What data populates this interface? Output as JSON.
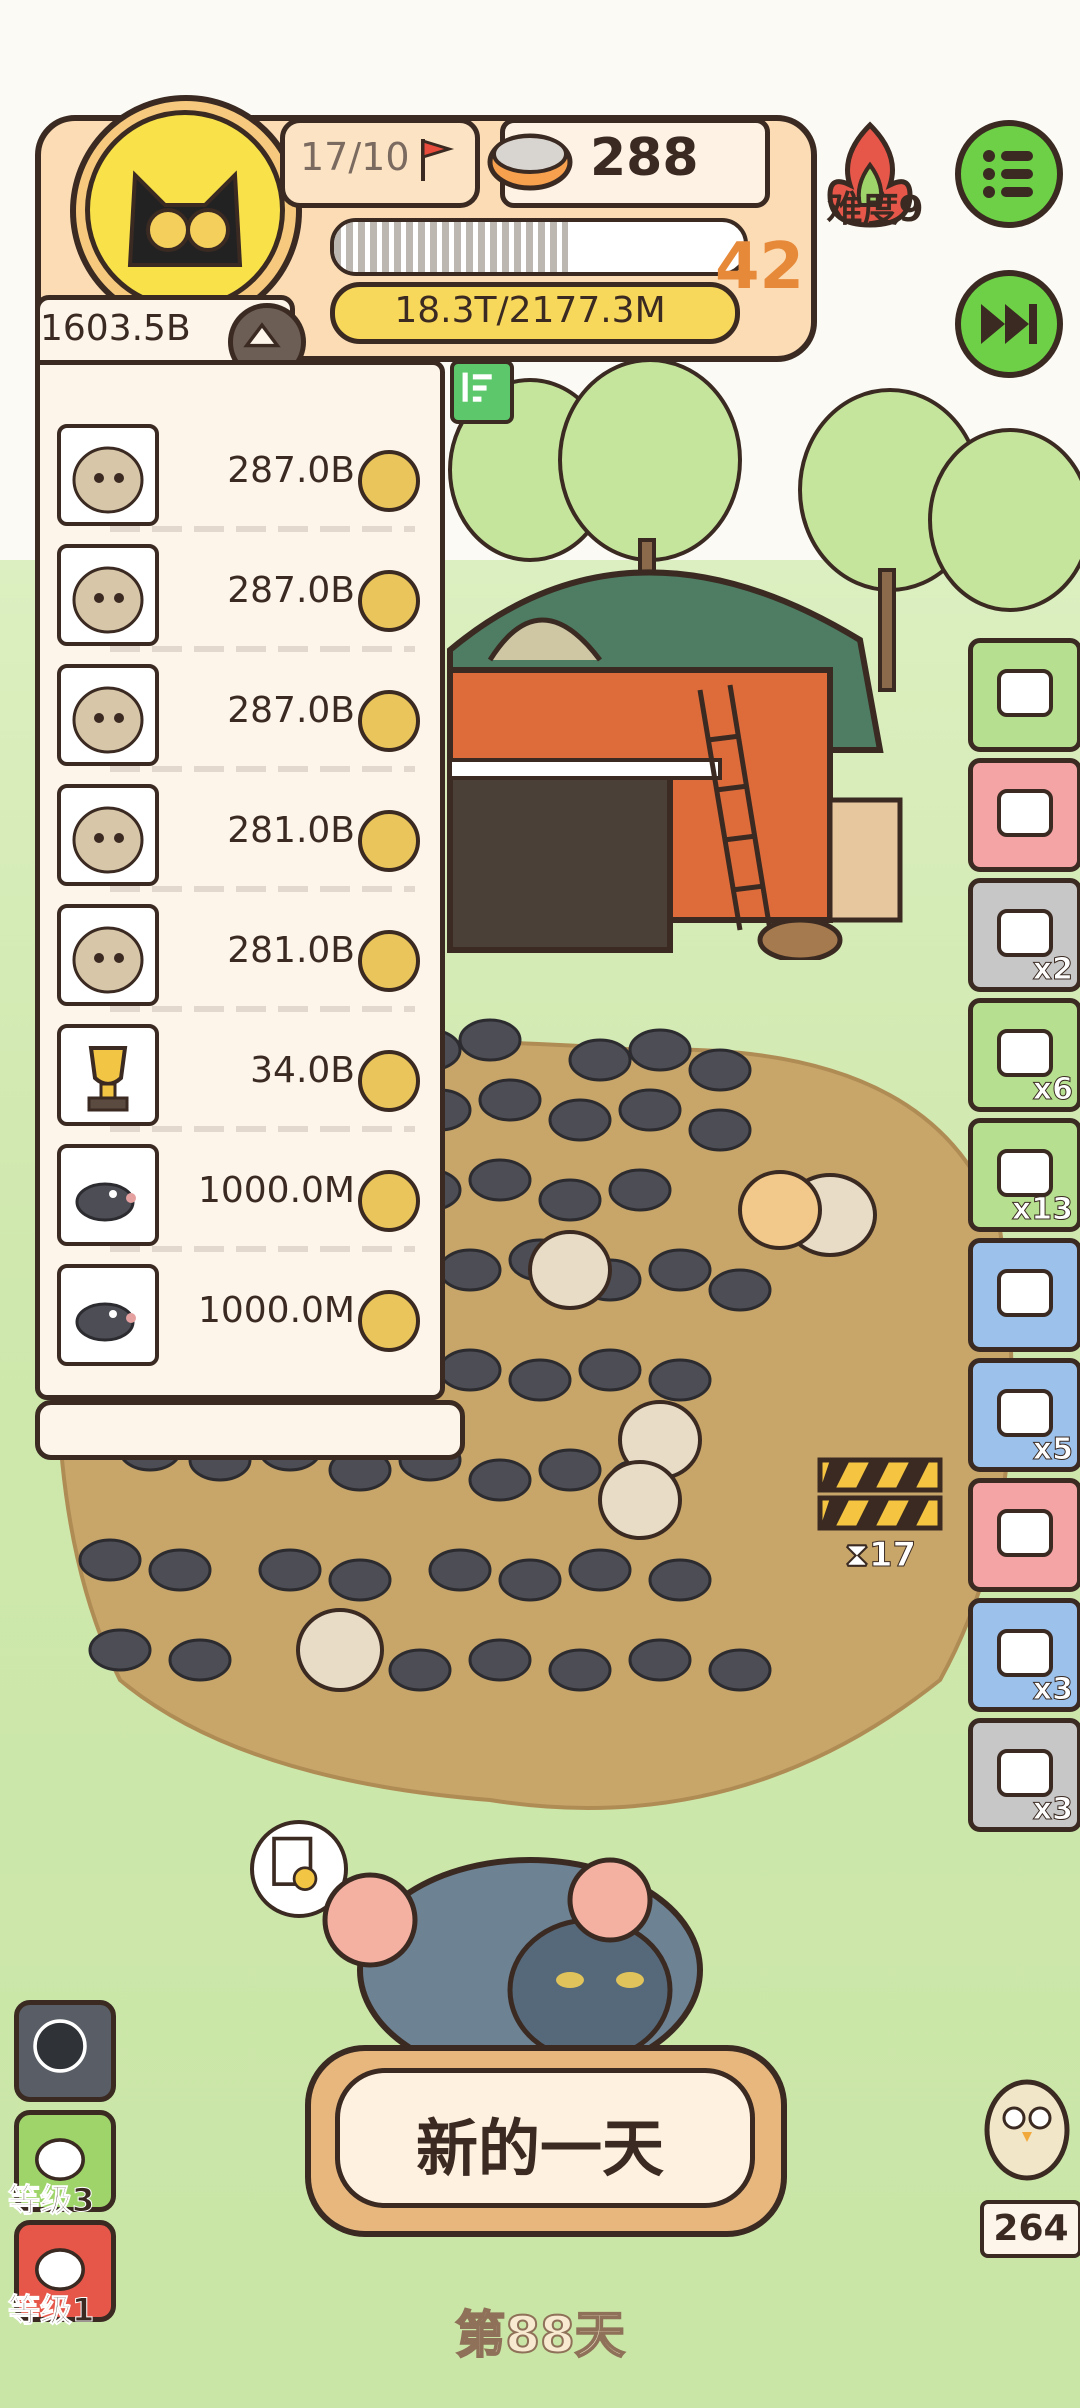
{
  "hud": {
    "population": "17/10",
    "food": "288",
    "level": "42",
    "money": "18.3T/2177.3M",
    "progress": 0.57,
    "difficulty_label": "难度9"
  },
  "ranking": {
    "total": "1603.5B",
    "rows": [
      {
        "creature": "hedgehog",
        "value": "287.0B"
      },
      {
        "creature": "hedgehog",
        "value": "287.0B"
      },
      {
        "creature": "hedgehog",
        "value": "287.0B"
      },
      {
        "creature": "hedgehog",
        "value": "281.0B"
      },
      {
        "creature": "hedgehog",
        "value": "281.0B"
      },
      {
        "creature": "trophy",
        "value": "34.0B"
      },
      {
        "creature": "mole",
        "value": "1000.0M"
      },
      {
        "creature": "mole",
        "value": "1000.0M"
      }
    ]
  },
  "items": [
    {
      "icon": "card-icon",
      "count": "",
      "color": "#b6e08f"
    },
    {
      "icon": "gift-box-icon",
      "count": "",
      "color": "#f4a4a4"
    },
    {
      "icon": "mushroom-icon",
      "count": "x2",
      "color": "#c7c7c7"
    },
    {
      "icon": "tent-icon",
      "count": "x6",
      "color": "#b6e08f"
    },
    {
      "icon": "ticket-icon",
      "count": "x13",
      "color": "#b6e08f"
    },
    {
      "icon": "trophy-icon",
      "count": "",
      "color": "#9cc2ec"
    },
    {
      "icon": "bag-icon",
      "count": "x5",
      "color": "#9cc2ec"
    },
    {
      "icon": "scissors-icon",
      "count": "",
      "color": "#f4a4a4"
    },
    {
      "icon": "radio-icon",
      "count": "x3",
      "color": "#9cc2ec"
    },
    {
      "icon": "paw-card-icon",
      "count": "x3",
      "color": "#c7c7c7"
    }
  ],
  "barrier_timer": "17",
  "bottom": {
    "new_day": "新的一天",
    "day": "第88天",
    "level3_label": "等级3",
    "level1_label": "等级1",
    "owl_count": "264"
  },
  "colors": {
    "outline": "#3a2a22",
    "accent_green": "#6ed046",
    "panel": "#fdf5ea"
  }
}
